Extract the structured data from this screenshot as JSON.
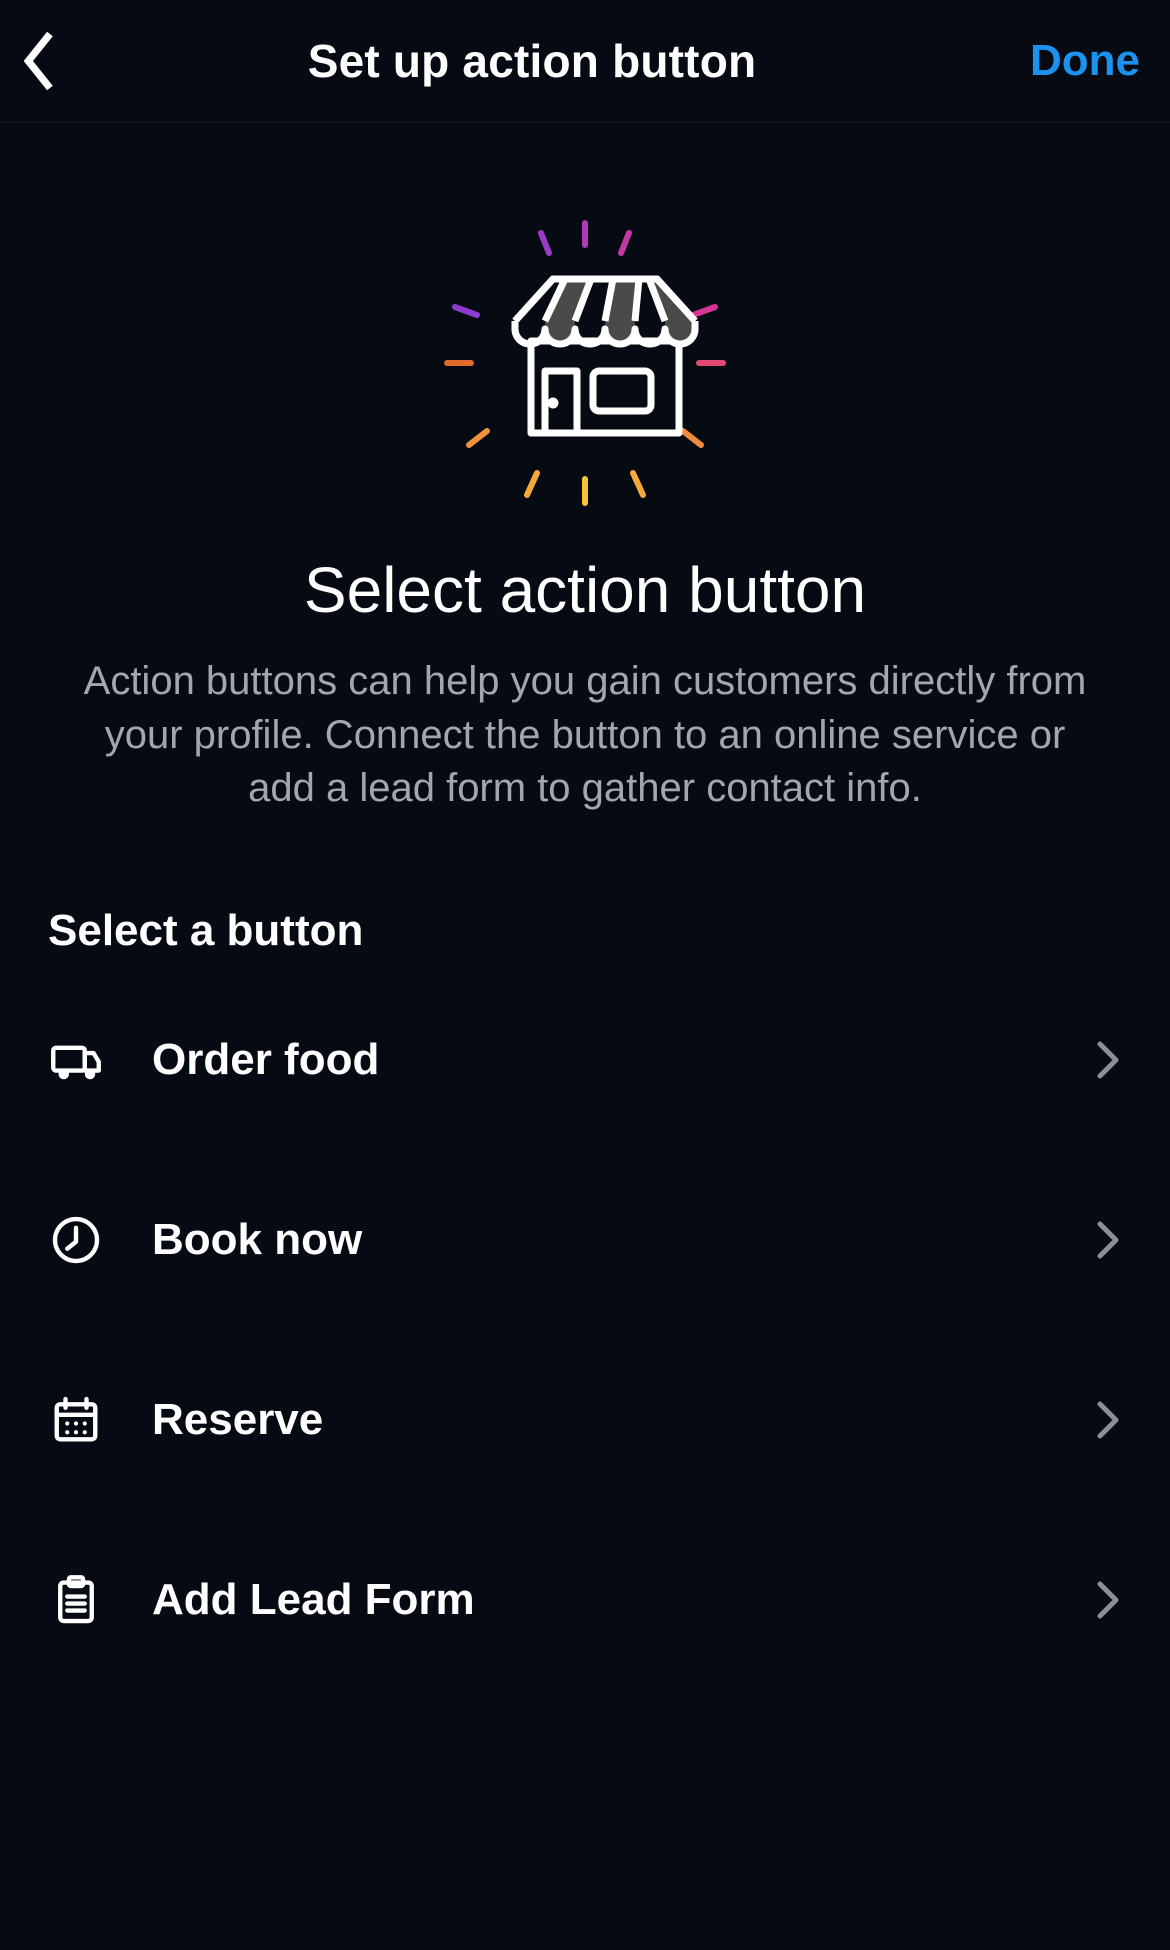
{
  "header": {
    "title": "Set up action button",
    "done_label": "Done"
  },
  "hero": {
    "title": "Select action button",
    "description": "Action buttons can help you gain customers directly from your profile. Connect the button to an online service or add a lead form to gather contact info."
  },
  "list": {
    "section_header": "Select a button",
    "items": [
      {
        "label": "Order food",
        "icon": "truck-icon"
      },
      {
        "label": "Book now",
        "icon": "clock-icon"
      },
      {
        "label": "Reserve",
        "icon": "calendar-icon"
      },
      {
        "label": "Add Lead Form",
        "icon": "clipboard-icon"
      }
    ]
  },
  "colors": {
    "accent": "#1b91f0",
    "bg": "#060a12",
    "text_secondary": "#a3a7ad",
    "spark_top": "#b13ab8",
    "spark_right": "#e0357f",
    "spark_bottom": "#f6a93b",
    "spark_left": "#e06a2c"
  }
}
